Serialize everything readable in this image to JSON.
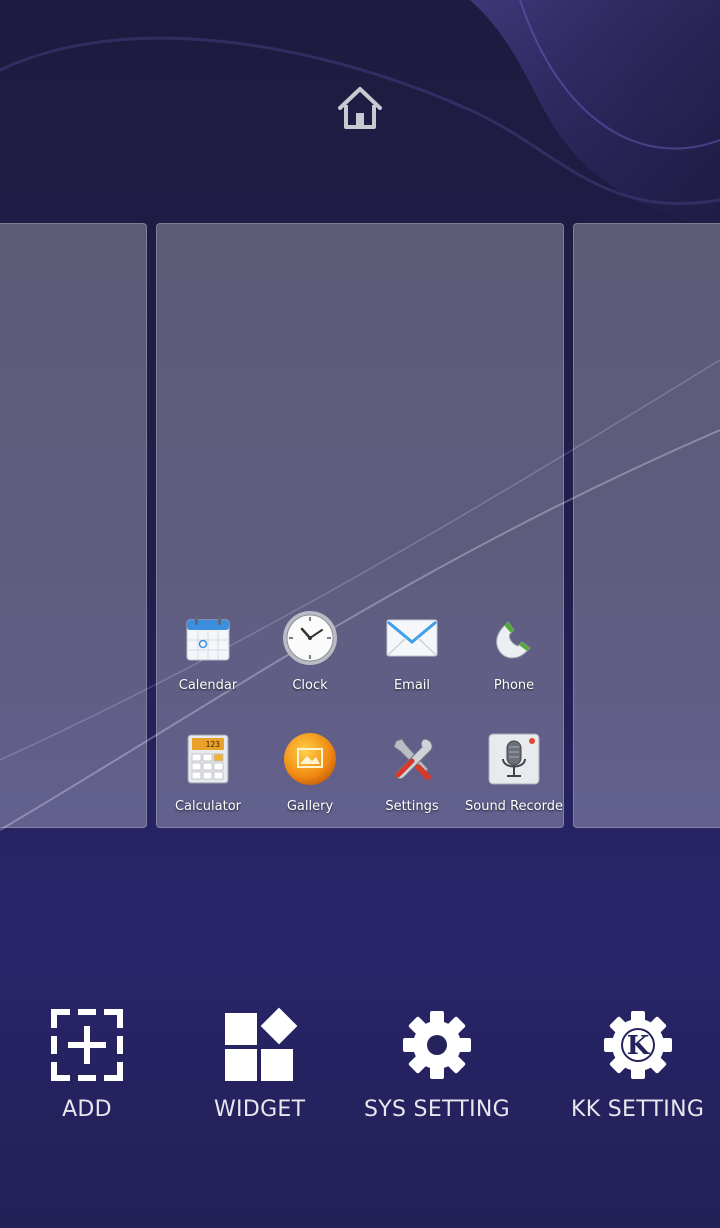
{
  "screen": {
    "home_icon": "home-icon"
  },
  "apps": [
    {
      "label": "Calendar",
      "icon": "calendar-icon"
    },
    {
      "label": "Clock",
      "icon": "clock-icon"
    },
    {
      "label": "Email",
      "icon": "email-icon"
    },
    {
      "label": "Phone",
      "icon": "phone-icon"
    },
    {
      "label": "Calculator",
      "icon": "calculator-icon"
    },
    {
      "label": "Gallery",
      "icon": "gallery-icon"
    },
    {
      "label": "Settings",
      "icon": "settings-icon"
    },
    {
      "label": "Sound Recorde",
      "icon": "sound-recorder-icon"
    }
  ],
  "calculator_display": "123",
  "actions": [
    {
      "label": "ADD",
      "icon": "add-icon"
    },
    {
      "label": "WIDGET",
      "icon": "widget-icon"
    },
    {
      "label": "SYS SETTING",
      "icon": "sys-setting-icon"
    },
    {
      "label": "KK SETTING",
      "icon": "kk-setting-icon"
    }
  ],
  "kk_badge_letter": "K",
  "colors": {
    "background": "#211e4c",
    "panel": "#8a87a0",
    "text": "#ffffff"
  }
}
